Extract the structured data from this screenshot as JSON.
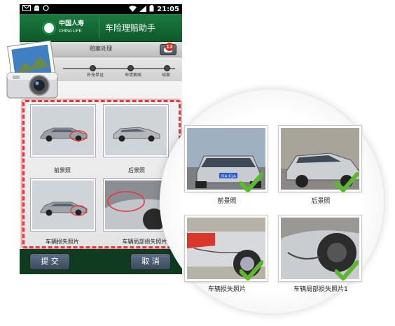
{
  "statusbar": {
    "time": "21:05"
  },
  "header": {
    "logo_cn": "中国人寿",
    "logo_en": "CHINA LIFE",
    "title": "车险理赔助手"
  },
  "subbar": {
    "title": "赔案处理",
    "message_badge": "12"
  },
  "progress": {
    "steps": [
      "补充单证",
      "申请索赔",
      "结案"
    ]
  },
  "photos": [
    {
      "label": "前景照"
    },
    {
      "label": "后景照"
    },
    {
      "label": "车辆损失照片"
    },
    {
      "label": "车辆局部损失照片1"
    }
  ],
  "buttons": {
    "submit": "提 交",
    "cancel": "取 消"
  },
  "zoom": {
    "labels": [
      "前景照",
      "后景照",
      "车辆损失照片",
      "车辆局部损失照片1"
    ],
    "plate": "川A·61A"
  },
  "colors": {
    "brand_green": "#0f3c20",
    "frame_red": "#e8343a",
    "check_green": "#5cb82e"
  }
}
